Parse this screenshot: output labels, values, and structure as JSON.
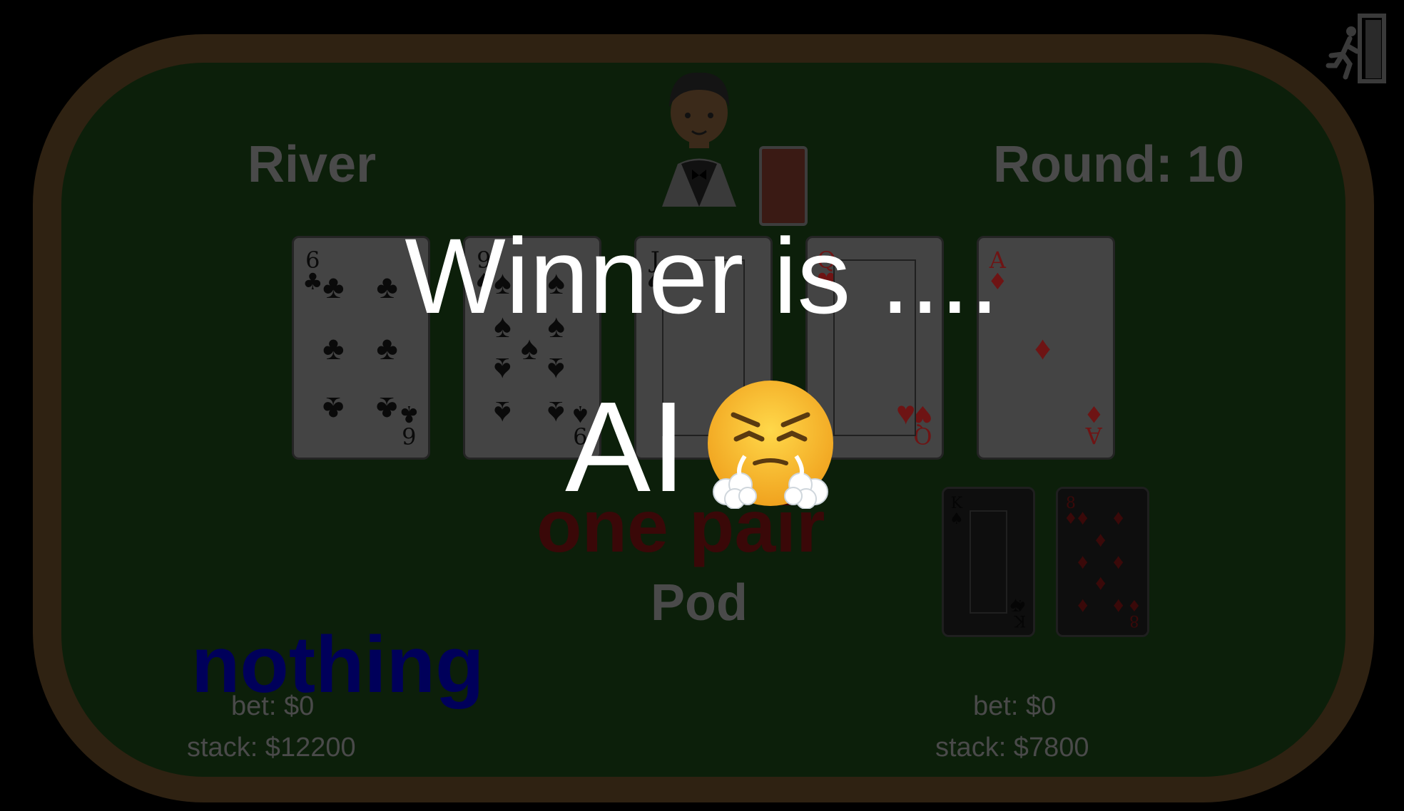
{
  "table": {
    "stage": "River",
    "round": "Round: 10",
    "pod_label": "Pod"
  },
  "community_cards": [
    {
      "rank": "6",
      "suit": "clubs",
      "suit_symbol": "♣",
      "color": "black"
    },
    {
      "rank": "9",
      "suit": "spades",
      "suit_symbol": "♠",
      "color": "black"
    },
    {
      "rank": "J",
      "suit": "spades",
      "suit_symbol": "♠",
      "color": "black"
    },
    {
      "rank": "Q",
      "suit": "hearts",
      "suit_symbol": "♥",
      "color": "red"
    },
    {
      "rank": "A",
      "suit": "diamonds",
      "suit_symbol": "♦",
      "color": "red"
    }
  ],
  "ai": {
    "hand_name": "one pair",
    "bet": "bet: $0",
    "stack": "stack: $7800",
    "hole_cards": [
      {
        "rank": "K",
        "suit_symbol": "♠",
        "color": "black"
      },
      {
        "rank": "8",
        "suit_symbol": "♦",
        "color": "red"
      }
    ]
  },
  "player": {
    "hand_name": "nothing",
    "bet": "bet: $0",
    "stack": "stack: $12200"
  },
  "overlay": {
    "title": "Winner is ....",
    "winner": "AI",
    "emoji": "face-with-steam-icon"
  },
  "exit_icon": "exit-door-icon",
  "colors": {
    "felt": "#0c1f0a",
    "rim": "#2f2212",
    "player_hand": "#00005a",
    "ai_hand": "#3a0808",
    "overlay_text": "#ffffff"
  }
}
